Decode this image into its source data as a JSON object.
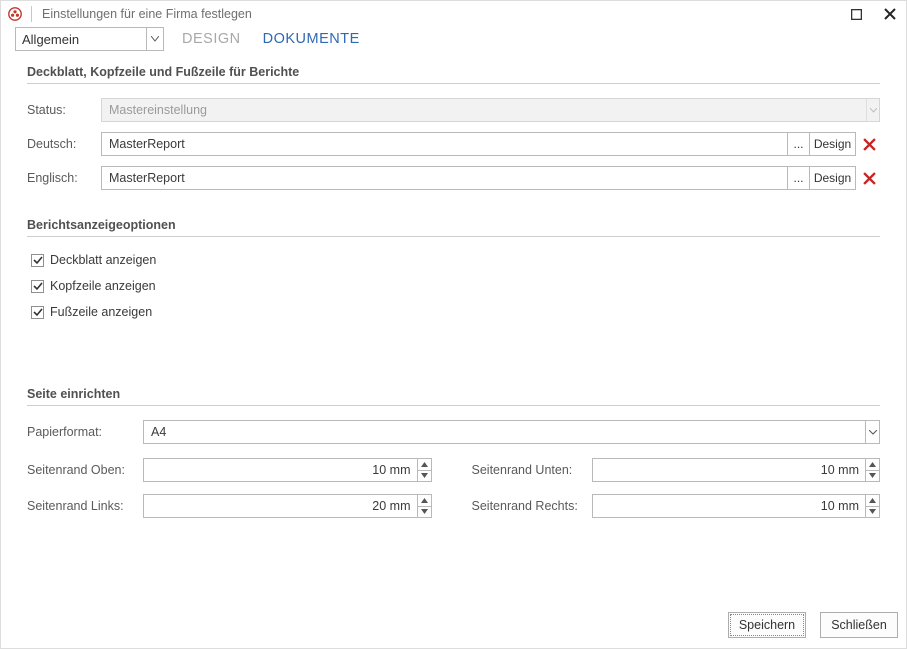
{
  "window": {
    "title": "Einstellungen für eine Firma festlegen"
  },
  "toolbar": {
    "dropdown": "Allgemein",
    "tabs": {
      "design": "DESIGN",
      "documents": "DOKUMENTE"
    }
  },
  "section_cover": {
    "heading": "Deckblatt, Kopfzeile und Fußzeile für Berichte",
    "status_label": "Status:",
    "status_value": "Mastereinstellung",
    "rows": {
      "de_label": "Deutsch:",
      "de_value": "MasterReport",
      "en_label": "Englisch:",
      "en_value": "MasterReport",
      "browse_label": "...",
      "design_label": "Design"
    }
  },
  "section_display": {
    "heading": "Berichtsanzeigeoptionen",
    "cb_cover": "Deckblatt anzeigen",
    "cb_header": "Kopfzeile anzeigen",
    "cb_footer": "Fußzeile anzeigen"
  },
  "section_page": {
    "heading": "Seite einrichten",
    "paper_label": "Papierformat:",
    "paper_value": "A4",
    "margin_top_label": "Seitenrand Oben:",
    "margin_top_value": "10 mm",
    "margin_bottom_label": "Seitenrand Unten:",
    "margin_bottom_value": "10 mm",
    "margin_left_label": "Seitenrand Links:",
    "margin_left_value": "20 mm",
    "margin_right_label": "Seitenrand Rechts:",
    "margin_right_value": "10 mm"
  },
  "footer": {
    "save": "Speichern",
    "close": "Schließen"
  }
}
